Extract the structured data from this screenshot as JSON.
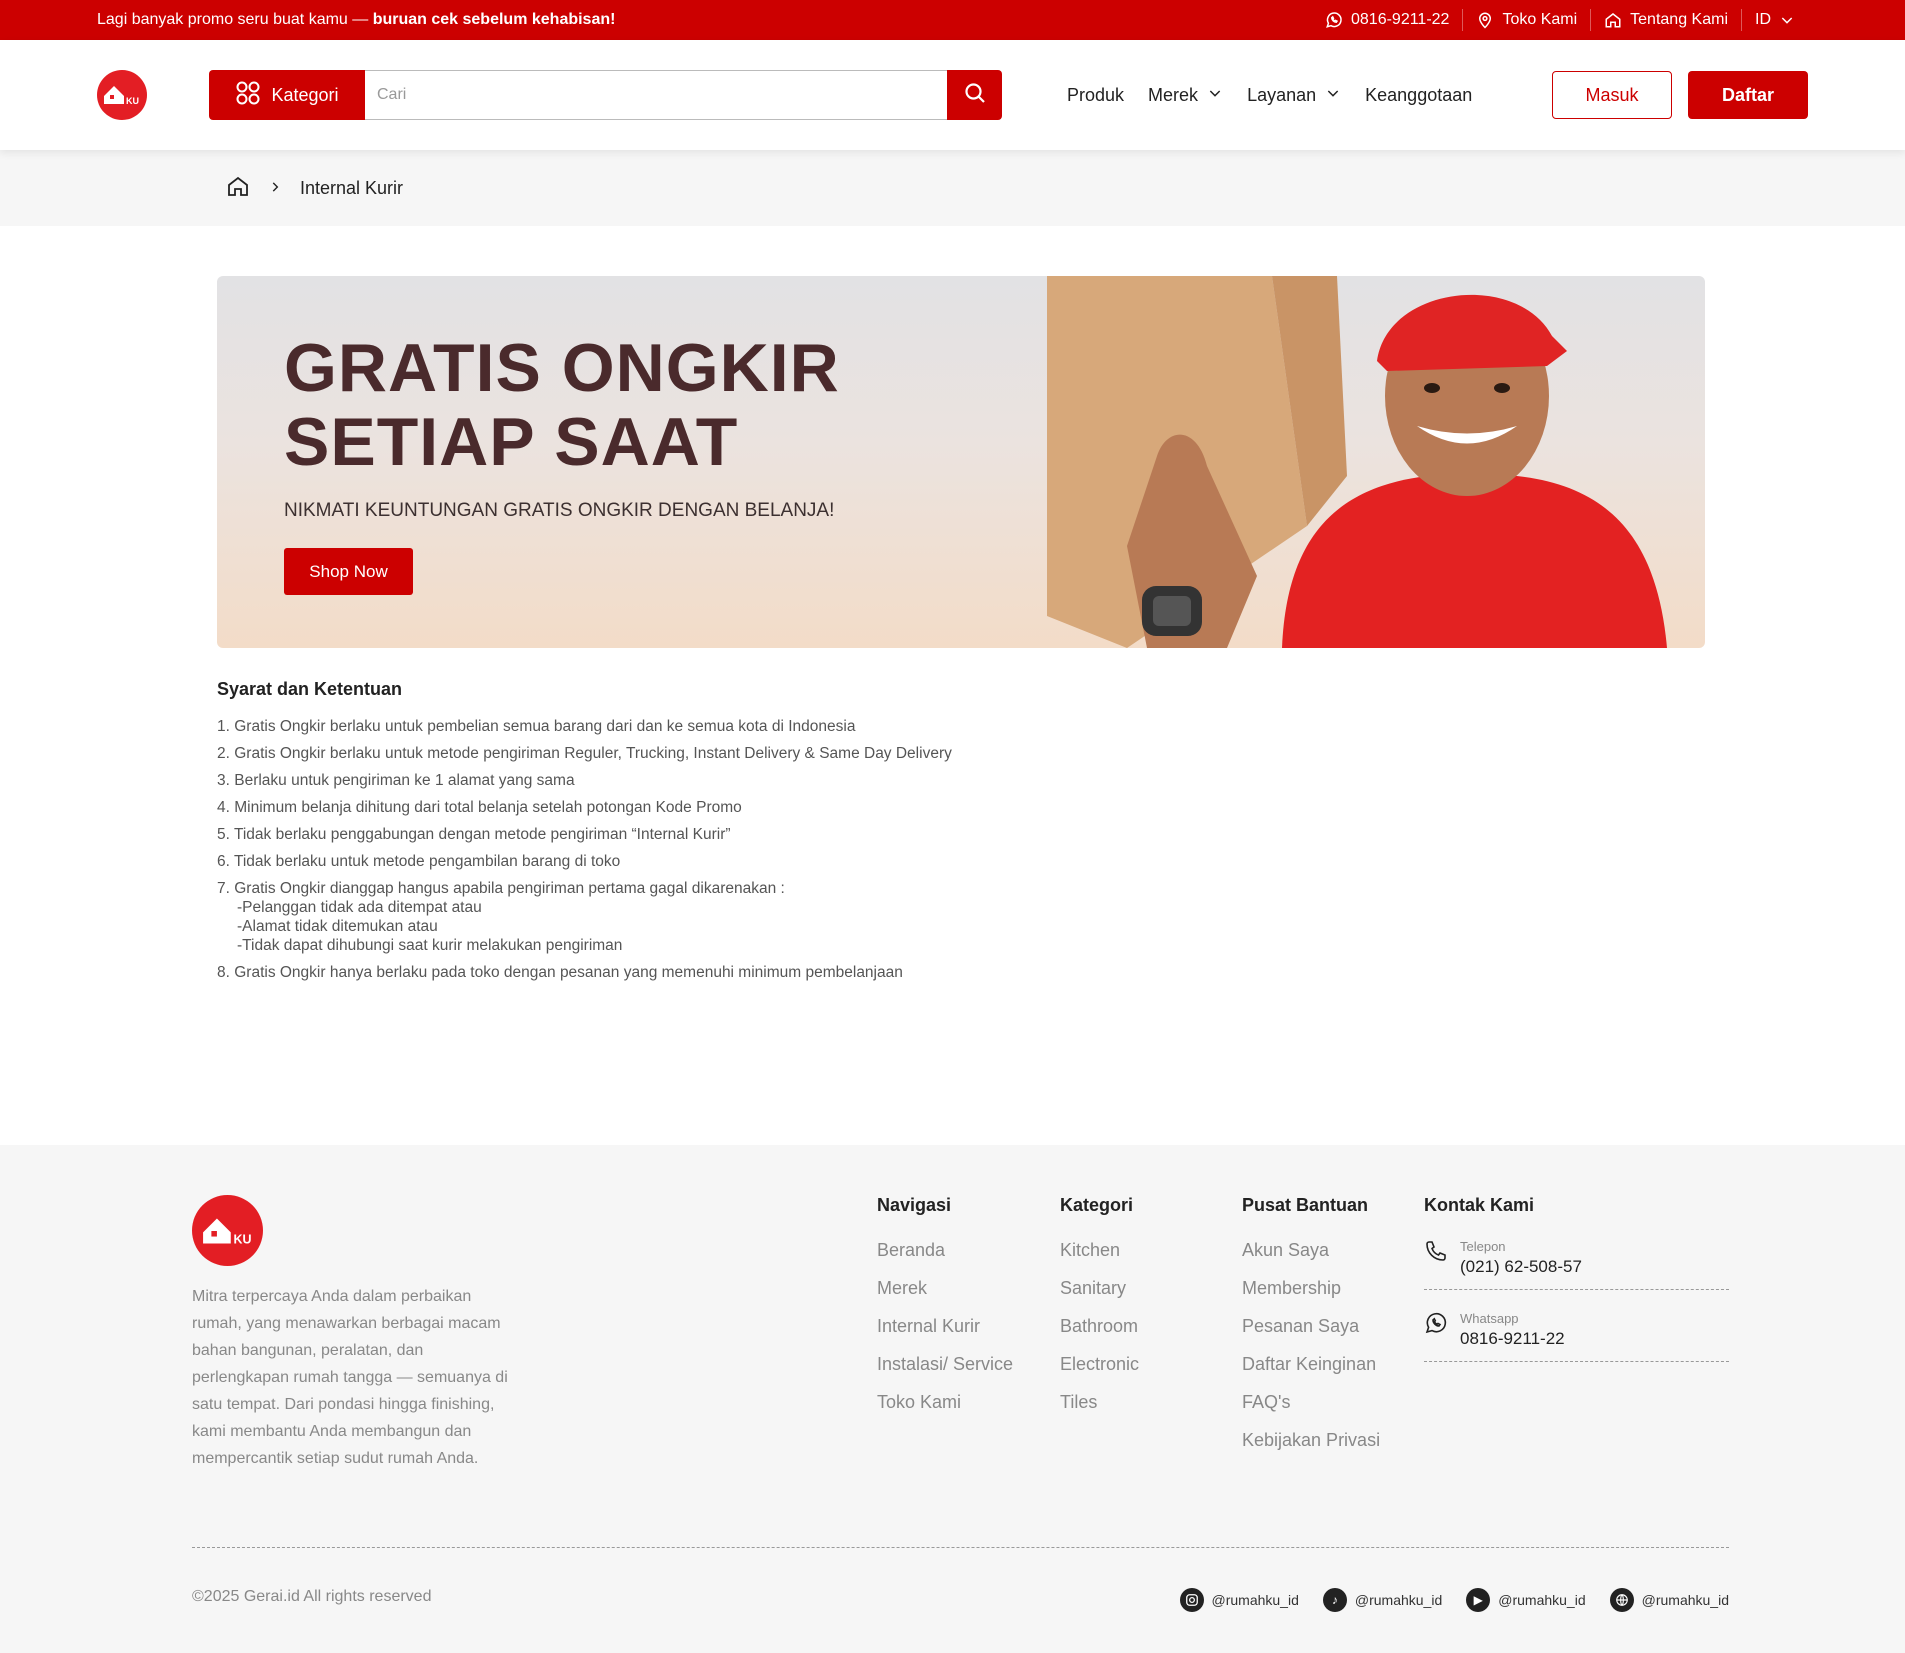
{
  "topbar": {
    "promo_text": "Lagi banyak promo seru buat kamu — ",
    "promo_bold": "buruan cek sebelum kehabisan!",
    "phone": "0816-9211-22",
    "store": "Toko Kami",
    "about": "Tentang Kami",
    "lang": "ID"
  },
  "header": {
    "category_button": "Kategori",
    "search_placeholder": "Cari",
    "nav": [
      "Produk",
      "Merek",
      "Layanan",
      "Keanggotaan"
    ],
    "login": "Masuk",
    "register": "Daftar"
  },
  "breadcrumb": {
    "current": "Internal Kurir"
  },
  "banner": {
    "title_line1": "GRATIS ONGKIR",
    "title_line2": "SETIAP SAAT",
    "subtitle": "NIKMATI KEUNTUNGAN GRATIS ONGKIR DENGAN BELANJA!",
    "cta": "Shop Now"
  },
  "terms": {
    "heading": "Syarat dan Ketentuan",
    "items": [
      "1. Gratis Ongkir berlaku untuk pembelian semua barang dari dan ke semua kota di Indonesia",
      "2. Gratis Ongkir berlaku untuk metode pengiriman Reguler, Trucking, Instant Delivery & Same Day Delivery",
      "3. Berlaku untuk pengiriman ke 1 alamat yang sama",
      "4. Minimum belanja dihitung dari total belanja setelah potongan Kode Promo",
      "5. Tidak berlaku penggabungan dengan metode pengiriman “Internal Kurir”",
      "6. Tidak berlaku untuk metode pengambilan barang di toko",
      "7. Gratis Ongkir dianggap hangus apabila pengiriman pertama gagal dikarenakan :",
      "8. Gratis Ongkir hanya berlaku pada toko dengan pesanan yang memenuhi minimum pembelanjaan"
    ],
    "sub_items": [
      "-Pelanggan tidak ada ditempat atau",
      "-Alamat tidak ditemukan atau",
      "-Tidak dapat dihubungi saat kurir melakukan pengiriman"
    ]
  },
  "footer": {
    "description": "Mitra terpercaya Anda dalam perbaikan rumah, yang menawarkan berbagai macam bahan bangunan, peralatan, dan perlengkapan rumah tangga — semuanya di satu tempat. Dari pondasi hingga finishing, kami membantu Anda membangun dan mempercantik setiap sudut rumah Anda.",
    "navigasi": {
      "title": "Navigasi",
      "links": [
        "Beranda",
        "Merek",
        "Internal Kurir",
        "Instalasi/ Service",
        "Toko Kami"
      ]
    },
    "kategori": {
      "title": "Kategori",
      "links": [
        "Kitchen",
        "Sanitary",
        "Bathroom",
        "Electronic",
        "Tiles"
      ]
    },
    "bantuan": {
      "title": "Pusat Bantuan",
      "links": [
        "Akun Saya",
        "Membership",
        "Pesanan Saya",
        "Daftar Keinginan",
        "FAQ's",
        "Kebijakan Privasi"
      ]
    },
    "kontak": {
      "title": "Kontak Kami",
      "phone_label": "Telepon",
      "phone": "(021) 62-508-57",
      "wa_label": "Whatsapp",
      "wa": "0816-9211-22"
    },
    "copyright": "©2025 Gerai.id All rights reserved",
    "socials": [
      "@rumahku_id",
      "@rumahku_id",
      "@rumahku_id",
      "@rumahku_id"
    ]
  },
  "colors": {
    "brand_red": "#cc0000",
    "logo_red": "#e31e24"
  }
}
